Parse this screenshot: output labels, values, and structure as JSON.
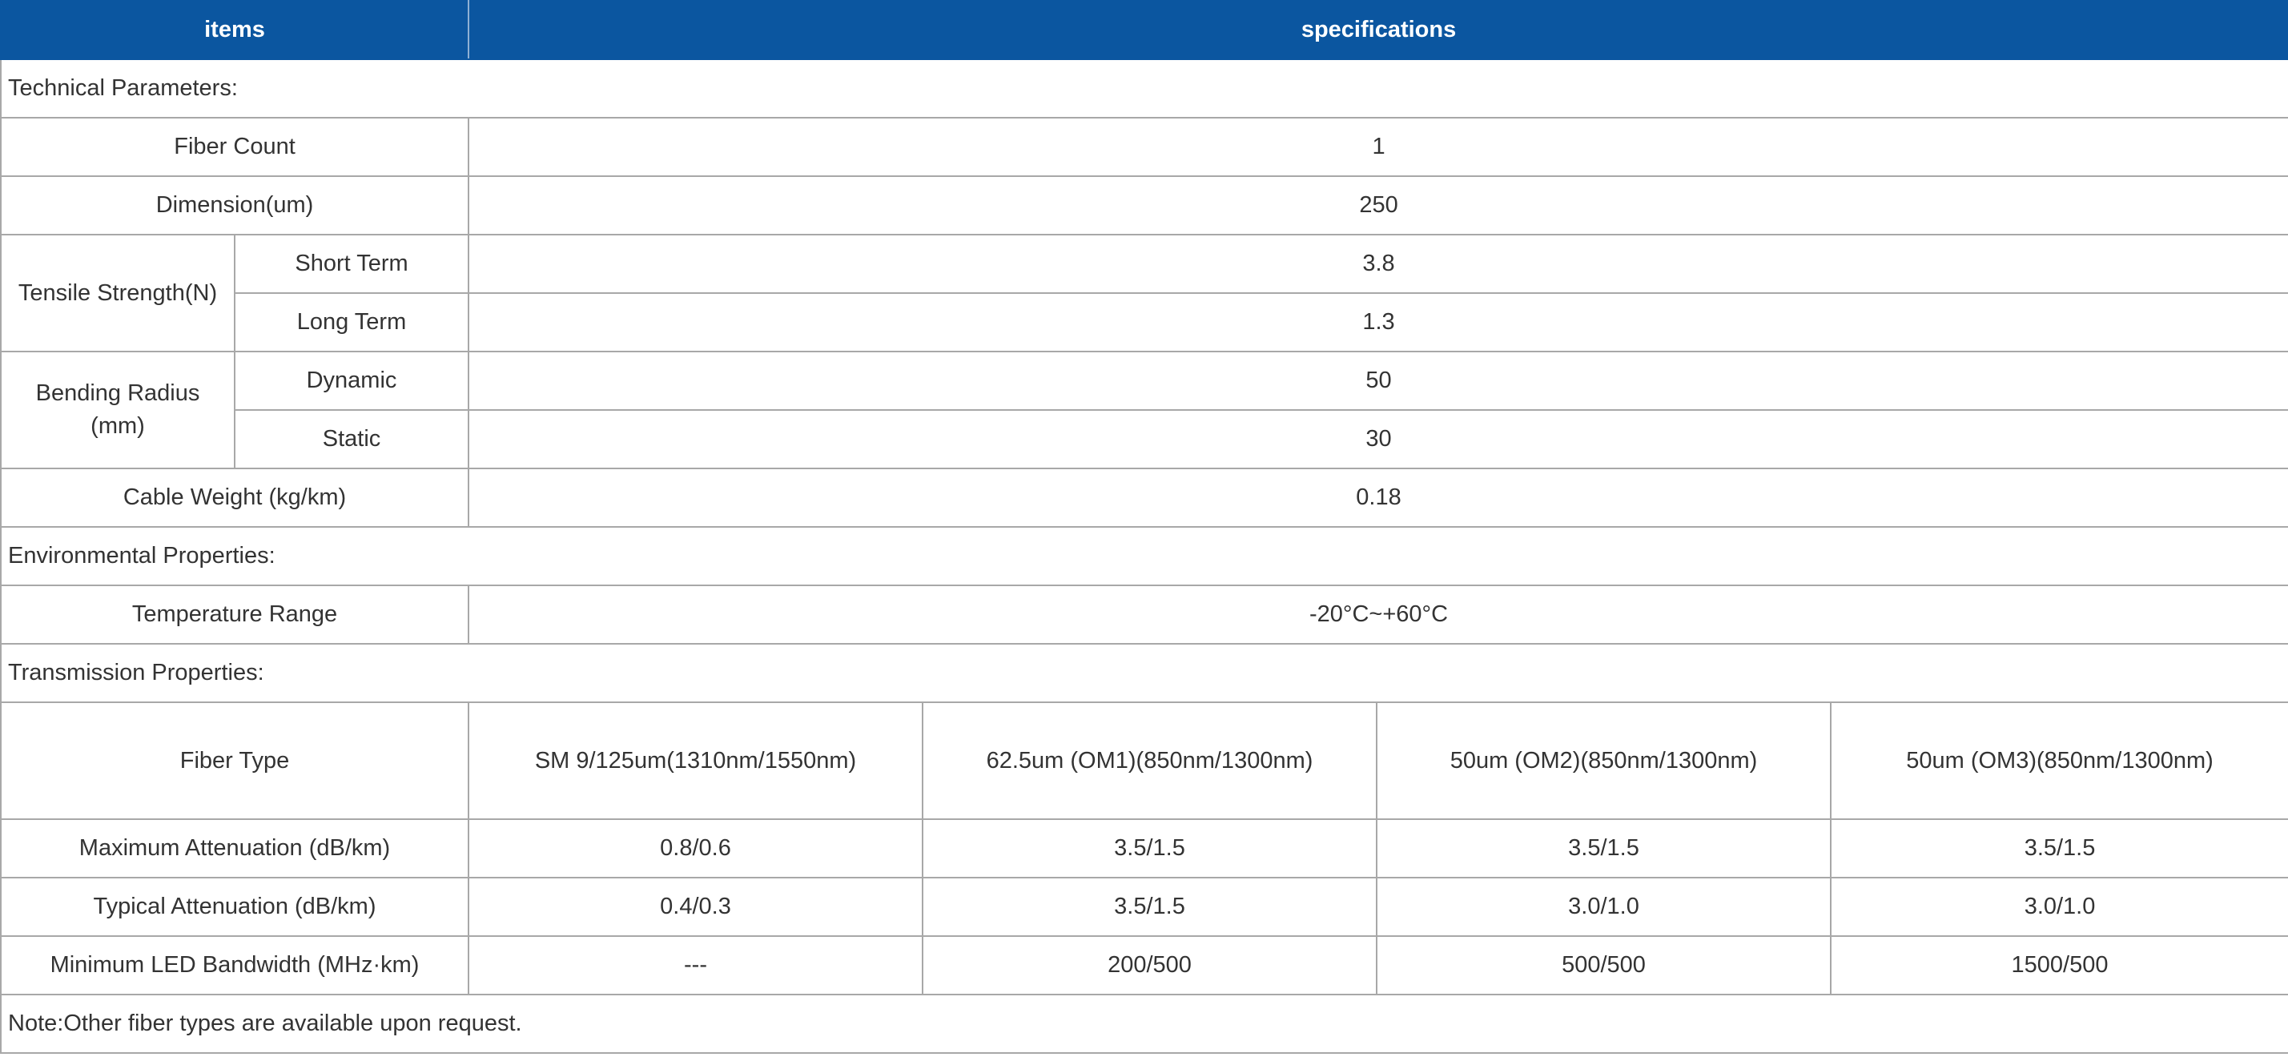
{
  "header": {
    "items": "items",
    "specifications": "specifications"
  },
  "sections": {
    "technical": "Technical Parameters:",
    "environmental": "Environmental Properties:",
    "transmission": "Transmission Properties:"
  },
  "technical": {
    "fiber_count": {
      "label": "Fiber Count",
      "value": "1"
    },
    "dimension": {
      "label": "Dimension(um)",
      "value": "250"
    },
    "tensile": {
      "label": "Tensile Strength(N)",
      "short_label": "Short Term",
      "short_value": "3.8",
      "long_label": "Long Term",
      "long_value": "1.3"
    },
    "bending": {
      "label": "Bending Radius (mm)",
      "dynamic_label": "Dynamic",
      "dynamic_value": "50",
      "static_label": "Static",
      "static_value": "30"
    },
    "weight": {
      "label": "Cable Weight (kg/km)",
      "value": "0.18"
    }
  },
  "environmental": {
    "temperature": {
      "label": "Temperature Range",
      "value": "-20°C~+60°C"
    }
  },
  "transmission": {
    "fiber_type": {
      "label": "Fiber Type",
      "values": [
        "SM 9/125um(1310nm/1550nm)",
        "62.5um (OM1)(850nm/1300nm)",
        "50um (OM2)(850nm/1300nm)",
        "50um (OM3)(850nm/1300nm)"
      ]
    },
    "max_atten": {
      "label": "Maximum Attenuation (dB/km)",
      "values": [
        "0.8/0.6",
        "3.5/1.5",
        "3.5/1.5",
        "3.5/1.5"
      ]
    },
    "typ_atten": {
      "label": "Typical Attenuation (dB/km)",
      "values": [
        "0.4/0.3",
        "3.5/1.5",
        "3.0/1.0",
        "3.0/1.0"
      ]
    },
    "led_bw": {
      "label": "Minimum LED Bandwidth (MHz·km)",
      "values": [
        "---",
        "200/500",
        "500/500",
        "1500/500"
      ]
    }
  },
  "note": "Note:Other fiber types are available upon request.",
  "colors": {
    "header_bg": "#0b56a0",
    "header_text": "#ffffff",
    "border": "#a8a8a8"
  }
}
